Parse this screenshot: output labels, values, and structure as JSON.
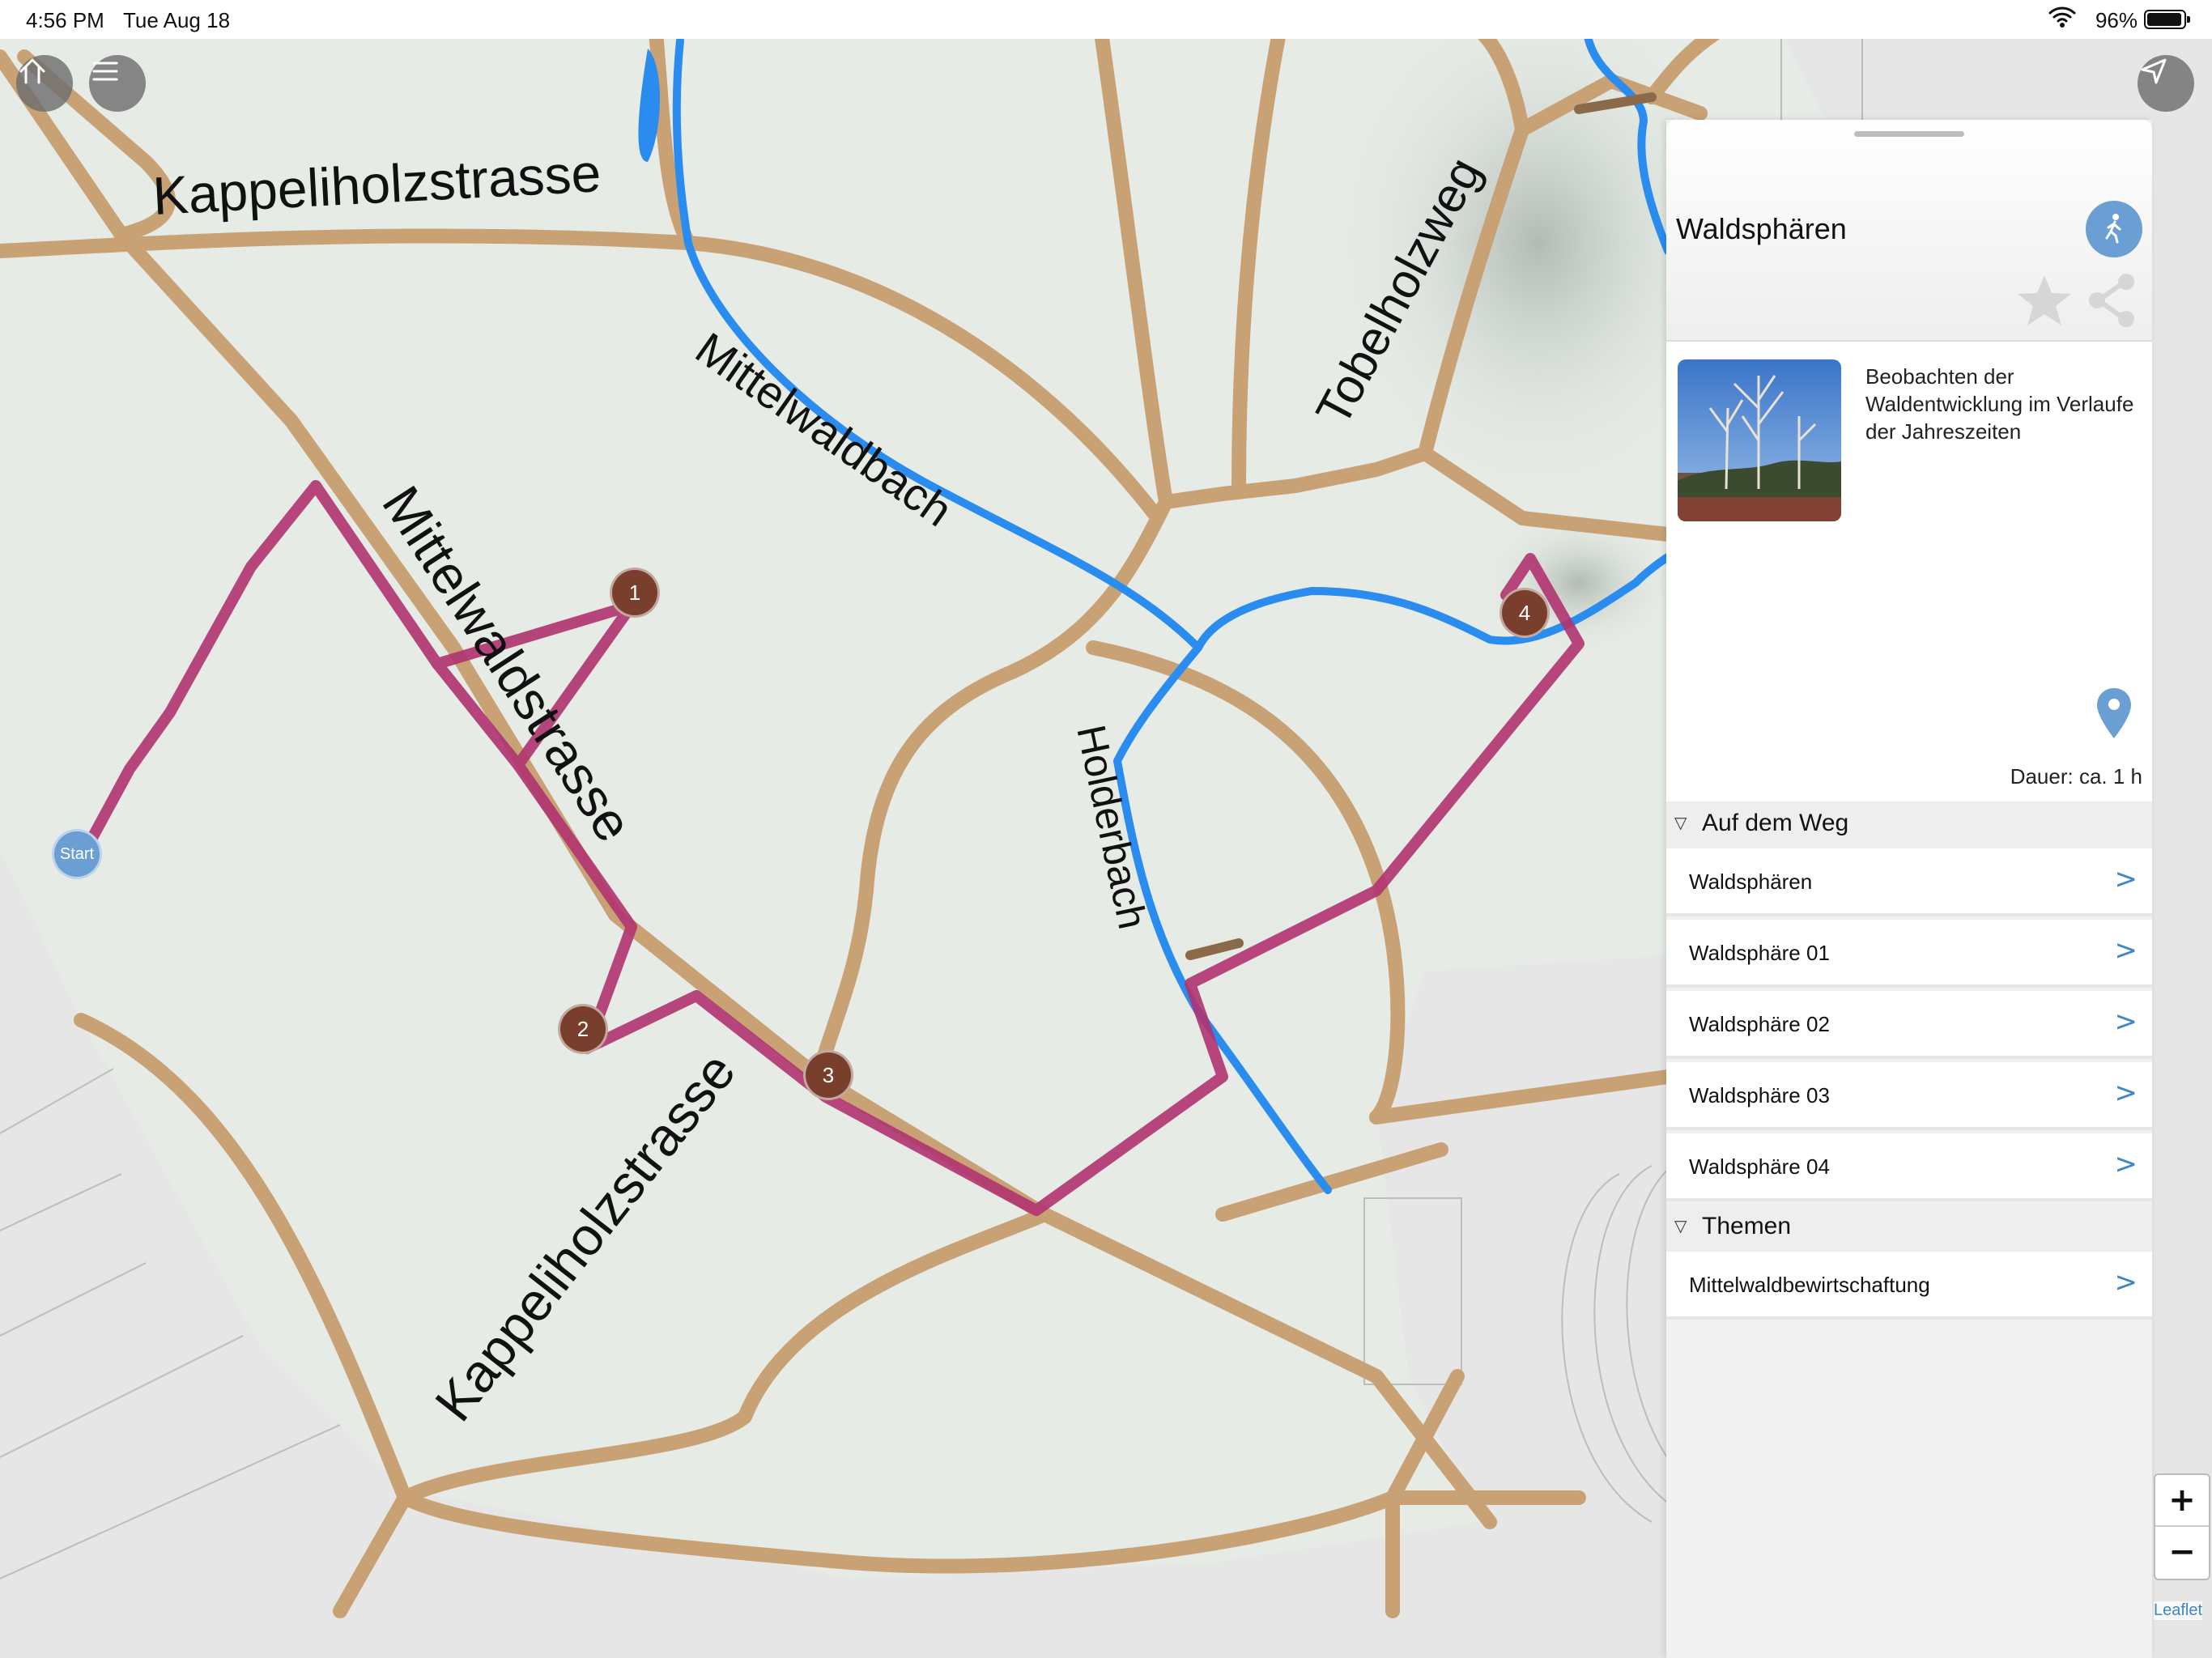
{
  "status_bar": {
    "time": "4:56 PM",
    "date": "Tue Aug 18",
    "battery": "96%",
    "battery_level": 0.96,
    "wifi_icon": "wifi-icon"
  },
  "map": {
    "labels": {
      "kappeliholzstrasse_top": "Kappeliholzstrasse",
      "mittelwaldbach": "Mittelwaldbach",
      "tobelholzweg": "Tobelholzweg",
      "mittelwaldstrasse": "Mittelwaldstrasse",
      "holderbach": "Holderbach",
      "kappeliholzstrasse_bottom": "Kappeliholzstrasse"
    },
    "markers": {
      "start": "Start",
      "m1": "1",
      "m2": "2",
      "m3": "3",
      "m4": "4"
    },
    "colors": {
      "background": "#e6ebe6",
      "road": "#c8a274",
      "water": "#2b8cf0",
      "route": "#b0336f",
      "marker": "#7a3f2c",
      "start": "#6b9fd3"
    },
    "zoom_in": "+",
    "zoom_out": "−",
    "attribution": "Leaflet"
  },
  "panel": {
    "title": "Waldsphären",
    "description": "Beobachten der Waldentwicklung im Verlaufe der Jahreszeiten",
    "duration": "Dauer: ca. 1 h",
    "sections": [
      {
        "label": "Auf dem Weg",
        "items": [
          "Waldsphären",
          "Waldsphäre 01",
          "Waldsphäre 02",
          "Waldsphäre 03",
          "Waldsphäre 04"
        ]
      },
      {
        "label": "Themen",
        "items": [
          "Mittelwaldbewirtschaftung"
        ]
      }
    ],
    "chevron": ">",
    "toggle": "▽"
  }
}
